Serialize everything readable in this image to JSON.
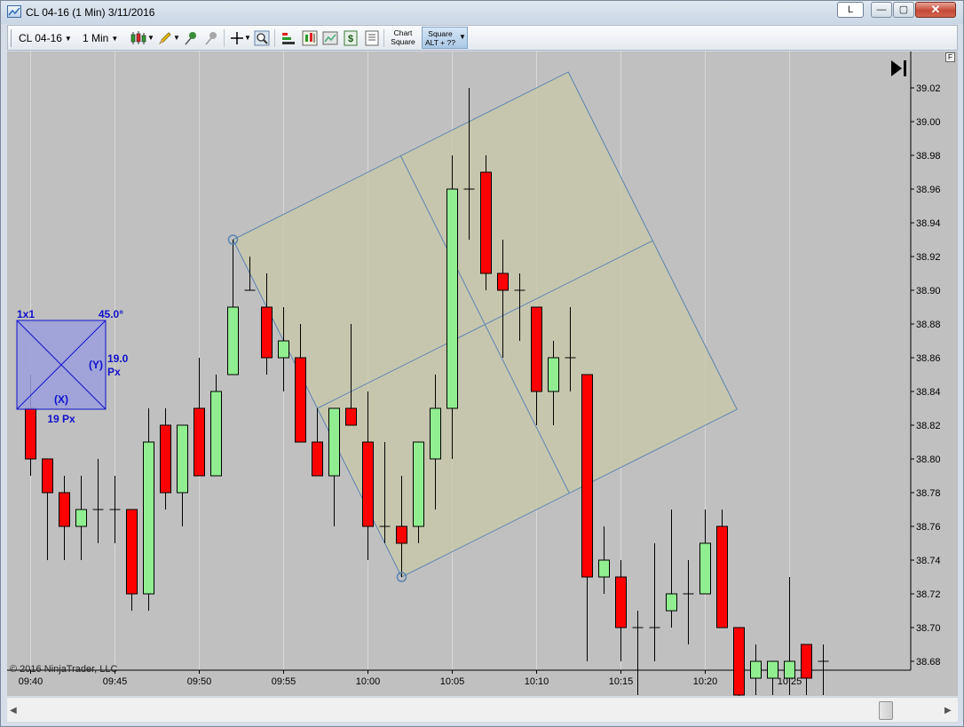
{
  "window": {
    "title": "CL 04-16 (1 Min)  3/11/2016",
    "link_button_label": "L",
    "minimize_glyph": "—",
    "maximize_glyph": "▢",
    "close_glyph": "✕"
  },
  "toolbar": {
    "instrument": "CL 04-16",
    "interval": "1 Min",
    "chart_square_label_line1": "Chart",
    "chart_square_label_line2": "Square",
    "square_label_line1": "Square",
    "square_label_line2": "ALT + ??",
    "icons": [
      "candlestick-icon",
      "pencil-icon",
      "pin-icon",
      "pin-grey-icon",
      "crosshair-icon",
      "zoom-icon",
      "bar-style-icon",
      "chart-style-icon",
      "chart-trader-icon",
      "dollar-icon",
      "properties-icon"
    ]
  },
  "colors": {
    "up_candle": "#90ee90",
    "down_candle": "#ff0000",
    "background": "#c0c0c0",
    "square_fill": "#c8c8a8",
    "square_stroke": "#5b84b0",
    "box_fill": "#9a9fdc",
    "box_text": "#1010cc"
  },
  "chart_data": {
    "type": "candlestick",
    "instrument": "CL 04-16",
    "interval": "1 Min",
    "ylim": [
      38.67,
      39.035
    ],
    "y_ticks": [
      "39.02",
      "39.00",
      "38.98",
      "38.96",
      "38.94",
      "38.92",
      "38.90",
      "38.88",
      "38.86",
      "38.84",
      "38.82",
      "38.80",
      "38.78",
      "38.76",
      "38.74",
      "38.72",
      "38.70",
      "38.68"
    ],
    "x_ticks": [
      "09:40",
      "09:45",
      "09:50",
      "09:55",
      "10:00",
      "10:05",
      "10:10",
      "10:15",
      "10:20",
      "10:25"
    ],
    "x_first_minute": "09:40",
    "candles": [
      {
        "t": "09:40",
        "o": 38.83,
        "h": 38.85,
        "l": 38.79,
        "c": 38.8
      },
      {
        "t": "09:41",
        "o": 38.8,
        "h": 38.8,
        "l": 38.74,
        "c": 38.78
      },
      {
        "t": "09:42",
        "o": 38.78,
        "h": 38.79,
        "l": 38.74,
        "c": 38.76
      },
      {
        "t": "09:43",
        "o": 38.76,
        "h": 38.79,
        "l": 38.74,
        "c": 38.77
      },
      {
        "t": "09:44",
        "o": 38.77,
        "h": 38.8,
        "l": 38.75,
        "c": 38.77
      },
      {
        "t": "09:45",
        "o": 38.77,
        "h": 38.79,
        "l": 38.75,
        "c": 38.77
      },
      {
        "t": "09:46",
        "o": 38.77,
        "h": 38.77,
        "l": 38.71,
        "c": 38.72
      },
      {
        "t": "09:47",
        "o": 38.72,
        "h": 38.83,
        "l": 38.71,
        "c": 38.81
      },
      {
        "t": "09:48",
        "o": 38.82,
        "h": 38.83,
        "l": 38.77,
        "c": 38.78
      },
      {
        "t": "09:49",
        "o": 38.78,
        "h": 38.82,
        "l": 38.76,
        "c": 38.82
      },
      {
        "t": "09:50",
        "o": 38.83,
        "h": 38.86,
        "l": 38.79,
        "c": 38.79
      },
      {
        "t": "09:51",
        "o": 38.79,
        "h": 38.85,
        "l": 38.79,
        "c": 38.84
      },
      {
        "t": "09:52",
        "o": 38.85,
        "h": 38.93,
        "l": 38.85,
        "c": 38.89
      },
      {
        "t": "09:53",
        "o": 38.9,
        "h": 38.92,
        "l": 38.9,
        "c": 38.9
      },
      {
        "t": "09:54",
        "o": 38.89,
        "h": 38.91,
        "l": 38.85,
        "c": 38.86
      },
      {
        "t": "09:55",
        "o": 38.86,
        "h": 38.89,
        "l": 38.84,
        "c": 38.87
      },
      {
        "t": "09:56",
        "o": 38.86,
        "h": 38.88,
        "l": 38.81,
        "c": 38.81
      },
      {
        "t": "09:57",
        "o": 38.81,
        "h": 38.83,
        "l": 38.79,
        "c": 38.79
      },
      {
        "t": "09:58",
        "o": 38.79,
        "h": 38.83,
        "l": 38.76,
        "c": 38.83
      },
      {
        "t": "09:59",
        "o": 38.83,
        "h": 38.88,
        "l": 38.82,
        "c": 38.82
      },
      {
        "t": "10:00",
        "o": 38.81,
        "h": 38.84,
        "l": 38.74,
        "c": 38.76
      },
      {
        "t": "10:01",
        "o": 38.76,
        "h": 38.81,
        "l": 38.75,
        "c": 38.76
      },
      {
        "t": "10:02",
        "o": 38.76,
        "h": 38.79,
        "l": 38.73,
        "c": 38.75
      },
      {
        "t": "10:03",
        "o": 38.76,
        "h": 38.81,
        "l": 38.75,
        "c": 38.81
      },
      {
        "t": "10:04",
        "o": 38.8,
        "h": 38.85,
        "l": 38.77,
        "c": 38.83
      },
      {
        "t": "10:05",
        "o": 38.83,
        "h": 38.98,
        "l": 38.8,
        "c": 38.96
      },
      {
        "t": "10:06",
        "o": 38.96,
        "h": 39.02,
        "l": 38.93,
        "c": 38.96
      },
      {
        "t": "10:07",
        "o": 38.97,
        "h": 38.98,
        "l": 38.9,
        "c": 38.91
      },
      {
        "t": "10:08",
        "o": 38.91,
        "h": 38.93,
        "l": 38.86,
        "c": 38.9
      },
      {
        "t": "10:09",
        "o": 38.9,
        "h": 38.91,
        "l": 38.87,
        "c": 38.9
      },
      {
        "t": "10:10",
        "o": 38.89,
        "h": 38.89,
        "l": 38.82,
        "c": 38.84
      },
      {
        "t": "10:11",
        "o": 38.84,
        "h": 38.87,
        "l": 38.82,
        "c": 38.86
      },
      {
        "t": "10:12",
        "o": 38.86,
        "h": 38.89,
        "l": 38.84,
        "c": 38.86
      },
      {
        "t": "10:13",
        "o": 38.85,
        "h": 38.85,
        "l": 38.68,
        "c": 38.73
      },
      {
        "t": "10:14",
        "o": 38.73,
        "h": 38.76,
        "l": 38.72,
        "c": 38.74
      },
      {
        "t": "10:15",
        "o": 38.73,
        "h": 38.74,
        "l": 38.68,
        "c": 38.7
      },
      {
        "t": "10:16",
        "o": 38.7,
        "h": 38.71,
        "l": 38.66,
        "c": 38.7
      },
      {
        "t": "10:17",
        "o": 38.7,
        "h": 38.75,
        "l": 38.68,
        "c": 38.7
      },
      {
        "t": "10:18",
        "o": 38.71,
        "h": 38.77,
        "l": 38.7,
        "c": 38.72
      },
      {
        "t": "10:19",
        "o": 38.72,
        "h": 38.74,
        "l": 38.69,
        "c": 38.72
      },
      {
        "t": "10:20",
        "o": 38.72,
        "h": 38.77,
        "l": 38.72,
        "c": 38.75
      },
      {
        "t": "10:21",
        "o": 38.76,
        "h": 38.77,
        "l": 38.7,
        "c": 38.7
      },
      {
        "t": "10:22",
        "o": 38.7,
        "h": 38.7,
        "l": 38.65,
        "c": 38.66
      },
      {
        "t": "10:23",
        "o": 38.67,
        "h": 38.69,
        "l": 38.66,
        "c": 38.68
      },
      {
        "t": "10:24",
        "o": 38.67,
        "h": 38.68,
        "l": 38.66,
        "c": 38.68
      },
      {
        "t": "10:25",
        "o": 38.67,
        "h": 38.73,
        "l": 38.66,
        "c": 38.68
      },
      {
        "t": "10:26",
        "o": 38.69,
        "h": 38.69,
        "l": 38.66,
        "c": 38.67
      },
      {
        "t": "10:27",
        "o": 38.68,
        "h": 38.69,
        "l": 38.66,
        "c": 38.68
      }
    ],
    "gann_square": {
      "anchor_start": {
        "t": "09:52",
        "price": 38.93
      },
      "anchor_end": {
        "t": "10:02",
        "price": 38.73
      }
    },
    "settings_box": {
      "ratio": "1x1",
      "angle": "45.0°",
      "y_label": "(Y)",
      "y_value": "19.0",
      "y_unit": "Px",
      "x_label": "(X)",
      "x_value": "19 Px"
    },
    "copyright": "© 2016 NinjaTrader, LLC",
    "price_panel_button": "F"
  }
}
